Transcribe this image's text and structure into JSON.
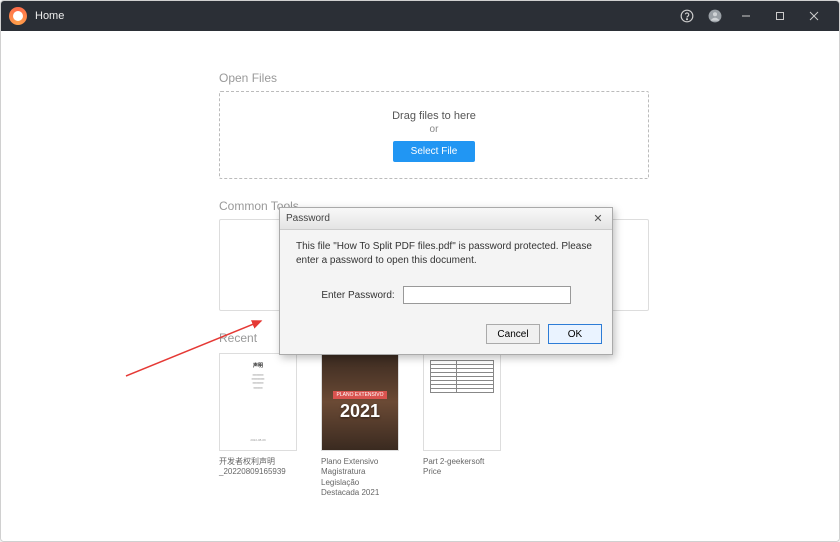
{
  "titlebar": {
    "title": "Home"
  },
  "open_files": {
    "section_label": "Open Files",
    "drag_text": "Drag files to here",
    "or_text": "or",
    "select_button": "Select File"
  },
  "common_tools": {
    "section_label": "Common Tools"
  },
  "recent": {
    "section_label": "Recent",
    "items": [
      {
        "title": "开发者权利声明_20220809165939",
        "thumb_type": "doc1"
      },
      {
        "title": "Plano Extensivo Magistratura Legislação Destacada 2021",
        "thumb_type": "doc2",
        "tag": "PLANO EXTENSIVO",
        "year": "2021"
      },
      {
        "title": "Part 2-geekersoft Price",
        "thumb_type": "doc3"
      }
    ]
  },
  "dialog": {
    "title": "Password",
    "message": "This file \"How To Split PDF files.pdf\" is password protected. Please enter a password to open this document.",
    "field_label": "Enter Password:",
    "cancel": "Cancel",
    "ok": "OK"
  }
}
